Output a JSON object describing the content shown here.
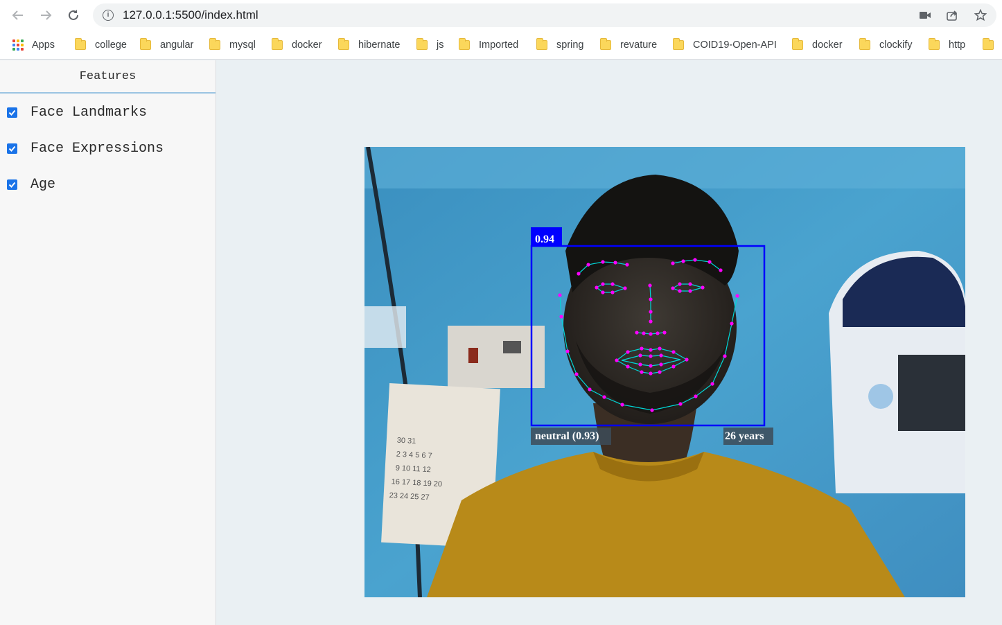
{
  "browser": {
    "url": "127.0.0.1:5500/index.html",
    "icons": {
      "back": "back-arrow-icon",
      "forward": "forward-arrow-icon",
      "reload": "reload-icon",
      "camera": "camera-icon",
      "share": "share-icon",
      "bookmark": "star-icon"
    }
  },
  "bookmarks": [
    {
      "label": "Apps",
      "icon": "apps-icon"
    },
    {
      "label": "college",
      "icon": "folder-icon"
    },
    {
      "label": "angular",
      "icon": "folder-icon"
    },
    {
      "label": "mysql",
      "icon": "folder-icon"
    },
    {
      "label": "docker",
      "icon": "folder-icon"
    },
    {
      "label": "hibernate",
      "icon": "folder-icon"
    },
    {
      "label": "js",
      "icon": "folder-icon"
    },
    {
      "label": "Imported",
      "icon": "folder-icon"
    },
    {
      "label": "spring",
      "icon": "folder-icon"
    },
    {
      "label": "revature",
      "icon": "folder-icon"
    },
    {
      "label": "COID19-Open-API",
      "icon": "folder-icon"
    },
    {
      "label": "docker",
      "icon": "folder-icon"
    },
    {
      "label": "clockify",
      "icon": "folder-icon"
    },
    {
      "label": "http",
      "icon": "folder-icon"
    }
  ],
  "sidebar": {
    "title": "Features",
    "features": [
      {
        "label": "Face Landmarks",
        "checked": true
      },
      {
        "label": "Face Expressions",
        "checked": true
      },
      {
        "label": "Age",
        "checked": true
      }
    ]
  },
  "detection": {
    "score": "0.94",
    "expression": "neutral (0.93)",
    "age": "26 years",
    "box_color": "#0000ff",
    "landmark_color": "#ff00ff",
    "contour_color": "#00e0e0"
  }
}
